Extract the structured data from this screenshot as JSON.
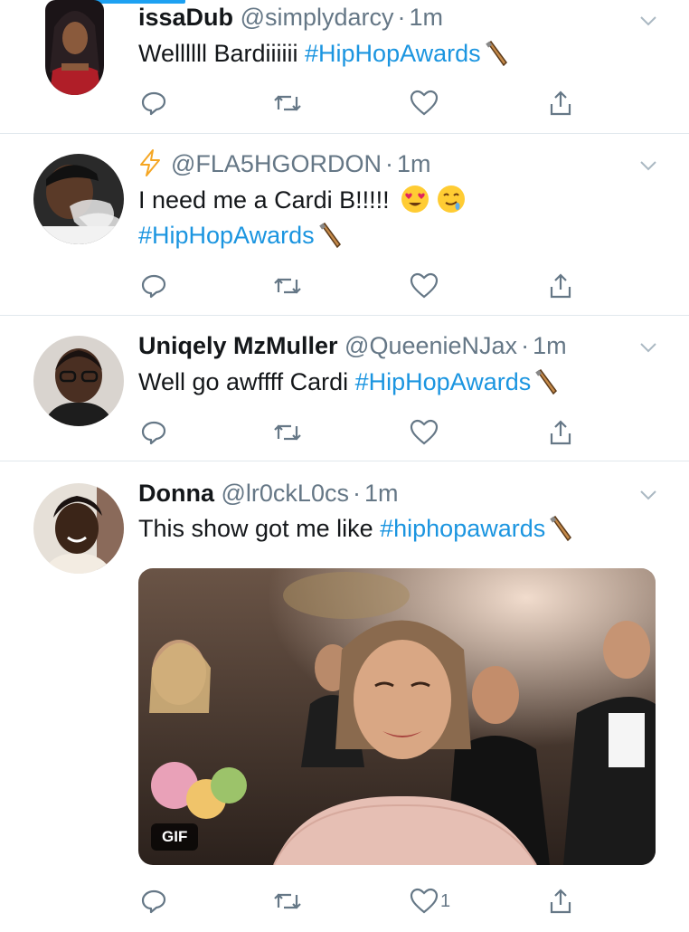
{
  "tweets": [
    {
      "display_name": "issaDub",
      "handle": "@simplydarcy",
      "separator": "·",
      "time": "1m",
      "text_prefix": "Wellllll Bardiiiiii ",
      "hashtag": "#HipHopAwards",
      "like_count": ""
    },
    {
      "display_name": "",
      "handle": "@FLA5HGORDON",
      "separator": "·",
      "time": "1m",
      "text_prefix": "I need me a Cardi B!!!!! ",
      "hashtag": "#HipHopAwards",
      "like_count": ""
    },
    {
      "display_name": "Uniqely MzMuller",
      "handle": "@QueenieNJax",
      "separator": "·",
      "time": "1m",
      "text_prefix": "Well go awffff Cardi ",
      "hashtag": "#HipHopAwards",
      "like_count": ""
    },
    {
      "display_name": "Donna",
      "handle": "@lr0ckL0cs",
      "separator": "·",
      "time": "1m",
      "text_prefix": "This show got me like ",
      "hashtag": "#hiphopawards",
      "like_count": "1",
      "media_badge": "GIF"
    }
  ],
  "icons": {
    "reply": "reply-icon",
    "retweet": "retweet-icon",
    "like": "heart-icon",
    "share": "share-icon",
    "more": "chevron-down-icon",
    "bolt": "lightning-icon"
  },
  "colors": {
    "hashtag": "#1b95e0",
    "muted": "#657786",
    "divider": "#e1e8ed",
    "accent": "#1da1f2"
  }
}
